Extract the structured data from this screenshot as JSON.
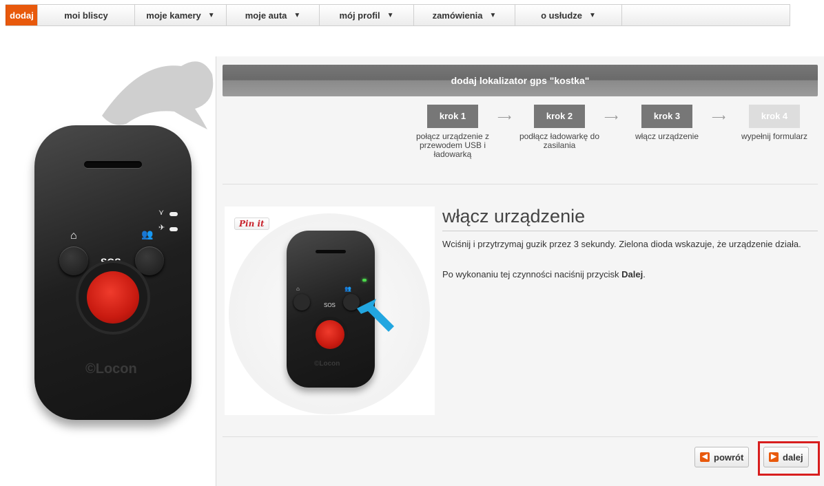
{
  "nav": {
    "items": [
      {
        "label": "dodaj",
        "active": true,
        "dropdown": false
      },
      {
        "label": "moi bliscy",
        "dropdown": false
      },
      {
        "label": "moje kamery",
        "dropdown": true
      },
      {
        "label": "moje auta",
        "dropdown": true
      },
      {
        "label": "mój profil",
        "dropdown": true
      },
      {
        "label": "zamówienia",
        "dropdown": true
      },
      {
        "label": "o usłudze",
        "dropdown": true
      }
    ]
  },
  "device": {
    "sos_label": "SOS",
    "brand": "©Locon"
  },
  "panel": {
    "title": "dodaj lokalizator gps \"kostka\"",
    "steps": [
      {
        "label": "krok 1",
        "desc": "połącz urządzenie z przewodem USB i ładowarką",
        "state": "done"
      },
      {
        "label": "krok 2",
        "desc": "podłącz ładowarkę do zasilania",
        "state": "done"
      },
      {
        "label": "krok 3",
        "desc": "włącz urządzenie",
        "state": "current"
      },
      {
        "label": "krok 4",
        "desc": "wypełnij formularz",
        "state": "pending"
      }
    ],
    "pin_label": "Pin it",
    "mini_device": {
      "sos_label": "SOS",
      "brand": "©Locon"
    },
    "heading": "włącz urządzenie",
    "paragraph1": "Wciśnij i przytrzymaj guzik przez 3 sekundy. Zielona dioda wskazuje, że urządzenie działa.",
    "paragraph2_prefix": "Po wykonaniu tej czynności naciśnij przycisk ",
    "paragraph2_bold": "Dalej",
    "paragraph2_suffix": ".",
    "back_label": "powrót",
    "next_label": "dalej"
  },
  "colors": {
    "accent": "#e8590c",
    "highlight": "#d81e1e",
    "title_bar": "#777777",
    "sos_red": "#d9231a"
  }
}
